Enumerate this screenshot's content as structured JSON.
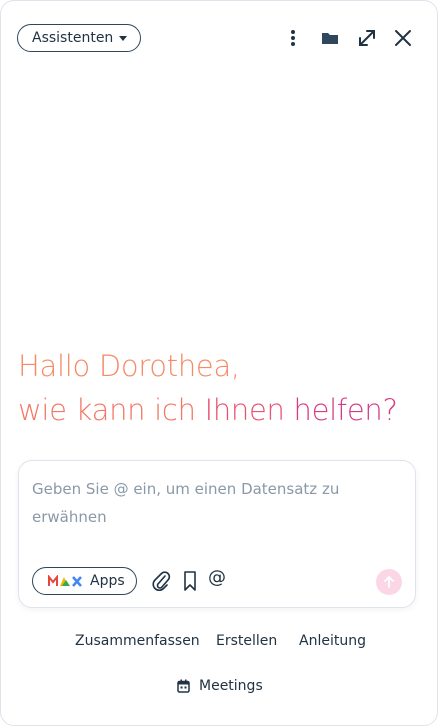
{
  "header": {
    "assistant_label": "Assistenten"
  },
  "greeting": {
    "line1": "Hallo Dorothea,",
    "line2_part1": "wie kann ich ",
    "line2_part2": "Ihnen ",
    "line2_part3": "helfen?"
  },
  "composer": {
    "placeholder": "Geben Sie @ ein, um einen Datensatz zu erwähnen",
    "value": "",
    "apps_label": "Apps",
    "at_symbol": "@"
  },
  "suggestions": [
    {
      "label": "Zusammenfassen"
    },
    {
      "label": "Erstellen"
    },
    {
      "label": "Anleitung"
    }
  ],
  "meetings_label": "Meetings",
  "colors": {
    "greeting_orange": "#f58a66",
    "greeting_pink": "#d63c86",
    "send_bg": "#fbd7e5",
    "text_dark": "#213343"
  }
}
